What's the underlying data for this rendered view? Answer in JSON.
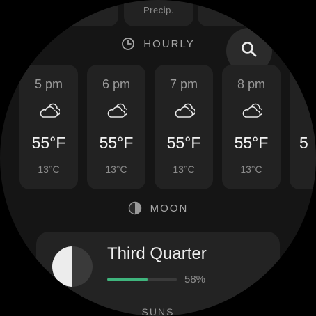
{
  "top": {
    "precip_label": "Precip."
  },
  "hourly": {
    "header_label": "HOURLY",
    "items": [
      {
        "time": "5 pm",
        "temp_f": "55°F",
        "temp_c": "13°C",
        "icon": "partly-cloudy-icon"
      },
      {
        "time": "6 pm",
        "temp_f": "55°F",
        "temp_c": "13°C",
        "icon": "partly-cloudy-icon"
      },
      {
        "time": "7 pm",
        "temp_f": "55°F",
        "temp_c": "13°C",
        "icon": "partly-cloudy-icon"
      },
      {
        "time": "8 pm",
        "temp_f": "55°F",
        "temp_c": "13°C",
        "icon": "partly-cloudy-icon"
      },
      {
        "time": "",
        "temp_f": "5",
        "temp_c": "",
        "icon": ""
      }
    ]
  },
  "search": {
    "icon": "search-icon"
  },
  "moon": {
    "header_label": "MOON",
    "phase": "Third Quarter",
    "illumination_text": "58%",
    "illumination": 0.58,
    "progress_color": "#3fb57d"
  },
  "bottom": {
    "partial_label": "SUNS"
  }
}
